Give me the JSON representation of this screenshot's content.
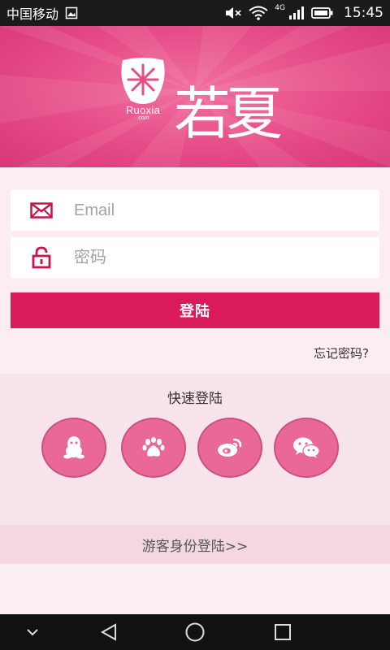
{
  "status_bar": {
    "carrier": "中国移动",
    "network": "4G",
    "time": "15:45",
    "icons": [
      "image-icon",
      "mute-icon",
      "wifi-icon",
      "signal-icon",
      "battery-icon"
    ]
  },
  "header": {
    "brand": "Ruoxia",
    "brand_suffix": ".com",
    "title": "若夏",
    "logo_icon": "flower-logo-icon",
    "colors": {
      "banner": "#e64c87",
      "banner_light": "#f06fa0"
    }
  },
  "form": {
    "email": {
      "placeholder": "Email",
      "value": "",
      "icon": "envelope-icon"
    },
    "password": {
      "placeholder": "密码",
      "value": "",
      "icon": "lock-icon"
    },
    "login_label": "登陆",
    "forgot_label": "忘记密码?",
    "colors": {
      "accent": "#d91b5b"
    }
  },
  "quick_login": {
    "title": "快速登陆",
    "providers": [
      {
        "name": "qq",
        "icon": "qq-icon"
      },
      {
        "name": "baidu",
        "icon": "paw-icon"
      },
      {
        "name": "weibo",
        "icon": "weibo-icon"
      },
      {
        "name": "wechat",
        "icon": "wechat-icon"
      }
    ],
    "colors": {
      "button": "#e96898"
    }
  },
  "guest": {
    "label": "游客身份登陆>>"
  },
  "nav_bar": {
    "icons": [
      "chevron-down-icon",
      "back-icon",
      "home-icon",
      "recents-icon"
    ]
  }
}
